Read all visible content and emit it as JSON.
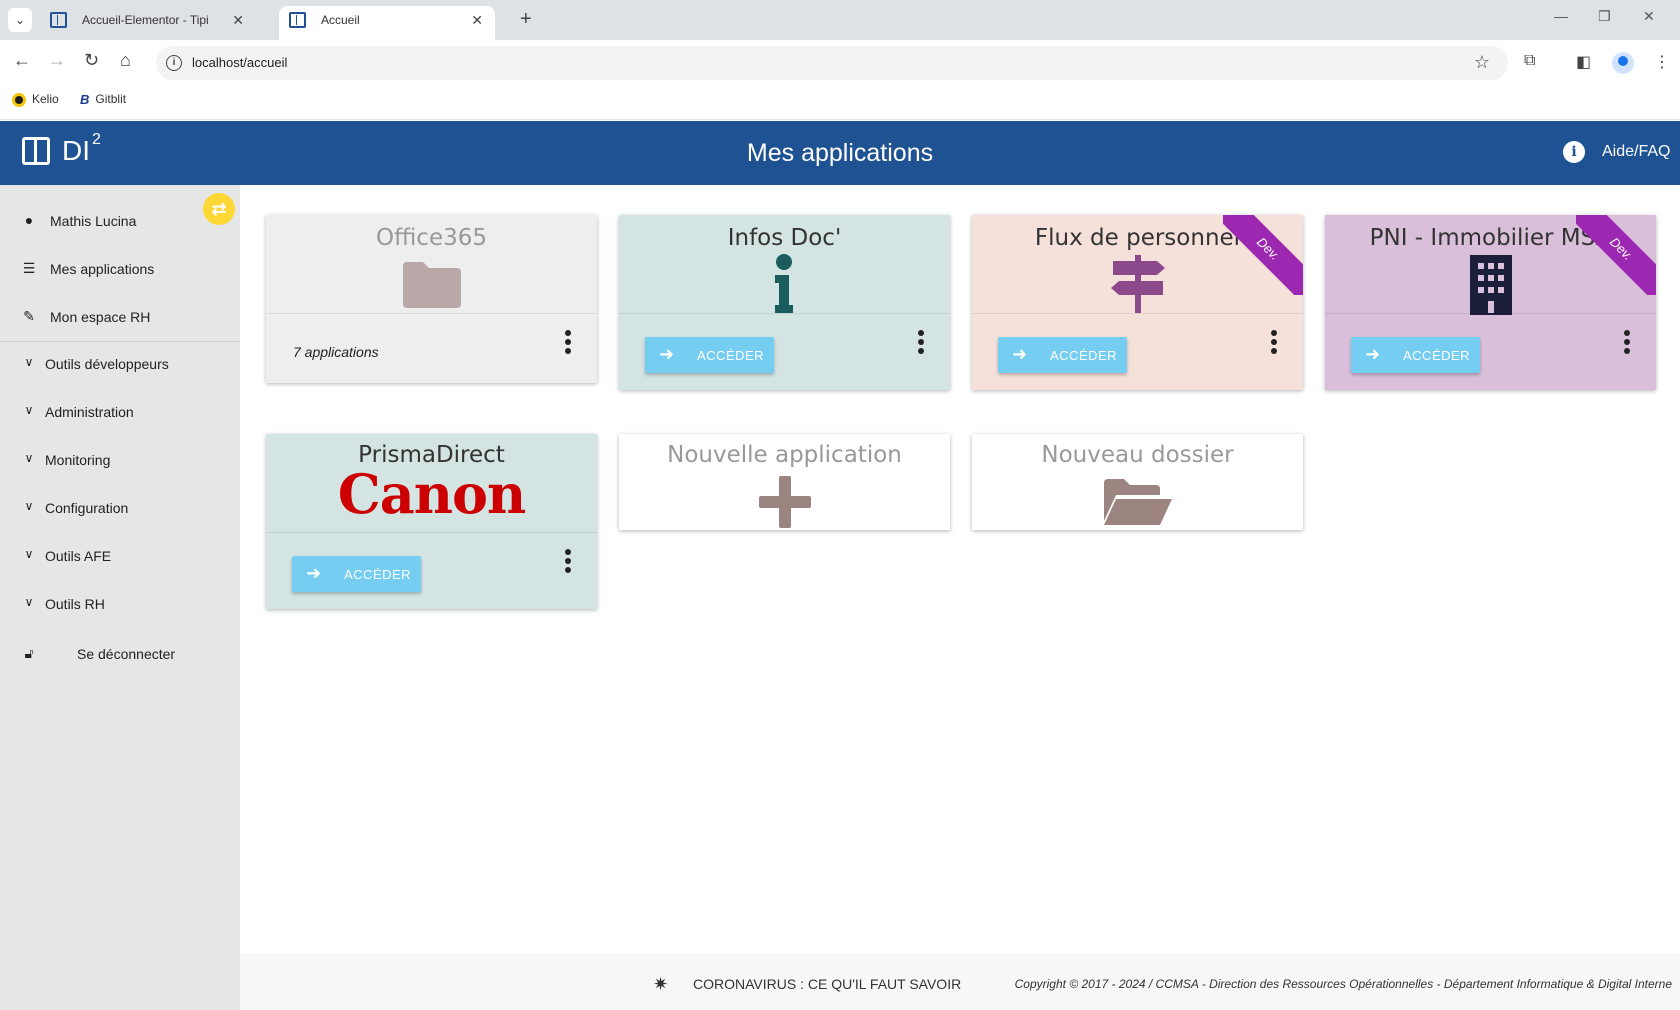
{
  "browser": {
    "tabs": [
      {
        "title": "Accueil-Elementor - Tipi",
        "active": false
      },
      {
        "title": "Accueil",
        "active": true
      }
    ],
    "url": "localhost/accueil",
    "bookmarks": [
      "Kelio",
      "Gitblit"
    ]
  },
  "header": {
    "logo_text": "DI",
    "logo_sup": "2",
    "title": "Mes applications",
    "help_label": "Aide/FAQ"
  },
  "sidebar": {
    "user": "Mathis Lucina",
    "items": [
      {
        "label": "Mes applications",
        "icon": "list-icon"
      },
      {
        "label": "Mon espace RH",
        "icon": "user-edit-icon"
      }
    ],
    "groups": [
      "Outils développeurs",
      "Administration",
      "Monitoring",
      "Configuration",
      "Outils AFE",
      "Outils RH"
    ],
    "logout": "Se déconnecter"
  },
  "cards": [
    {
      "title": "Office365",
      "icon": "folder-icon",
      "footer_text": "7 applications"
    },
    {
      "title": "Infos Doc'",
      "icon": "info-icon",
      "button": "ACCÉDER"
    },
    {
      "title": "Flux de personnel",
      "icon": "signpost-icon",
      "button": "ACCÉDER",
      "ribbon": "Dev."
    },
    {
      "title": "PNI - Immobilier MSA",
      "icon": "building-icon",
      "button": "ACCÉDER",
      "ribbon": "Dev."
    },
    {
      "title": "PrismaDirect",
      "logo_text": "Canon",
      "button": "ACCÉDER"
    },
    {
      "title": "Nouvelle application",
      "icon": "plus-icon"
    },
    {
      "title": "Nouveau dossier",
      "icon": "folder-open-icon"
    }
  ],
  "colors": {
    "brand": "#1e5292",
    "card_grey": "#eeeeee",
    "card_teal": "#d3e4e3",
    "card_pink": "#f5e0da",
    "card_purple": "#d9bfd9",
    "button": "#75cdf2",
    "ribbon": "#9c27b0",
    "canon_red": "#cc0000"
  },
  "footer": {
    "link": "CORONAVIRUS : CE QU'IL FAUT SAVOIR",
    "copyright": "Copyright © 2017 - 2024 / CCMSA - Direction des Ressources Opérationnelles - Département Informatique & Digital Interne"
  }
}
